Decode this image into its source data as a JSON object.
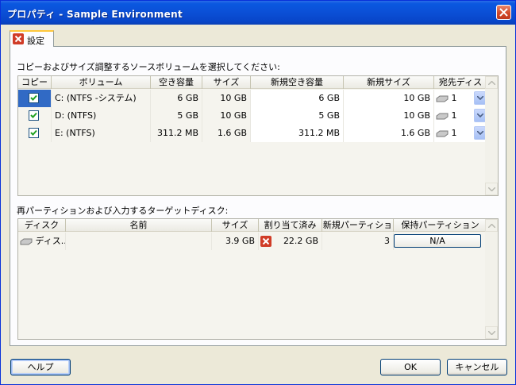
{
  "window": {
    "title": "プロパティ - Sample Environment"
  },
  "tab": {
    "label": "設定"
  },
  "source": {
    "label": "コピーおよびサイズ調整するソースボリュームを選択してください:",
    "columns": [
      "コピー",
      "ボリューム",
      "空き容量",
      "サイズ",
      "新規空き容量",
      "新規サイズ",
      "宛先ディス"
    ],
    "rows": [
      {
        "checked": true,
        "volume": "C: (NTFS -システム)",
        "free": "6 GB",
        "size": "10 GB",
        "new_free": "6 GB",
        "new_size": "10 GB",
        "dest": "1"
      },
      {
        "checked": true,
        "volume": "D: (NTFS)",
        "free": "5 GB",
        "size": "10 GB",
        "new_free": "5 GB",
        "new_size": "10 GB",
        "dest": "1"
      },
      {
        "checked": true,
        "volume": "E: (NTFS)",
        "free": "311.2 MB",
        "size": "1.6 GB",
        "new_free": "311.2 MB",
        "new_size": "1.6 GB",
        "dest": "1"
      }
    ]
  },
  "target": {
    "label": "再パーティションおよび入力するターゲットディスク:",
    "columns": [
      "ディスク",
      "名前",
      "サイズ",
      "割り当て済み",
      "新規パーティショ",
      "保持パーティション"
    ],
    "rows": [
      {
        "disk": "ディス...",
        "name": "",
        "size": "3.9 GB",
        "allocated": "22.2 GB",
        "new_partition": "3",
        "keep": "N/A"
      }
    ]
  },
  "buttons": {
    "help": "ヘルプ",
    "ok": "OK",
    "cancel": "キャンセル"
  },
  "colors": {
    "title_bar": "#0a58e0",
    "selected_cell": "#316ac5",
    "check": "#21a121",
    "error_icon": "#d03c27"
  }
}
